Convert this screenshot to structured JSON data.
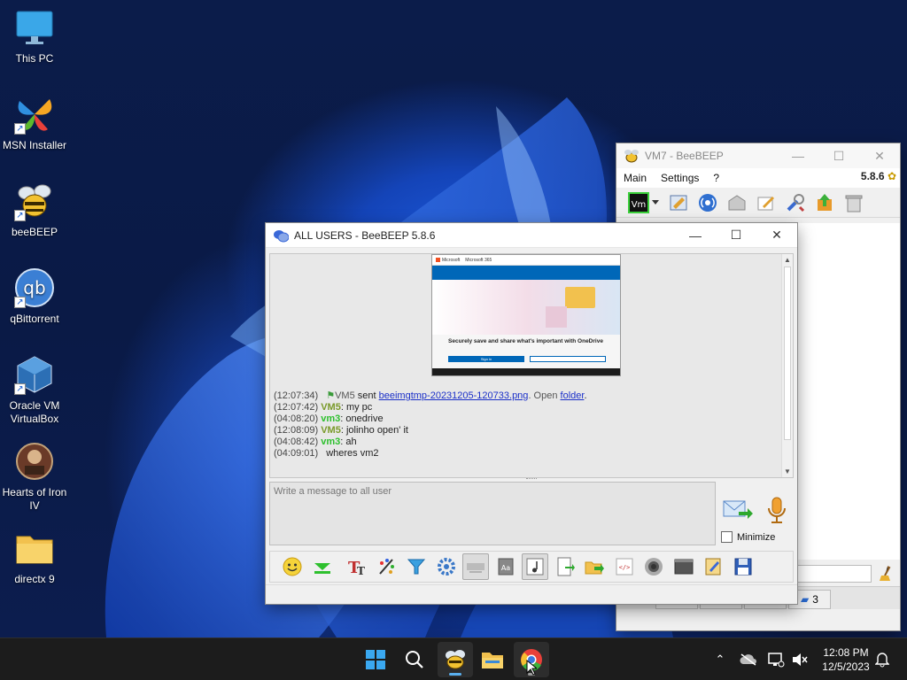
{
  "desktop": {
    "icons": [
      {
        "label": "This PC"
      },
      {
        "label": "MSN Installer"
      },
      {
        "label": "beeBEEP"
      },
      {
        "label": "qBittorrent"
      },
      {
        "label": "Oracle VM VirtualBox"
      },
      {
        "label": "Hearts of Iron IV"
      },
      {
        "label": "directx 9"
      }
    ]
  },
  "vm7_window": {
    "title": "VM7 - BeeBEEP",
    "menu": [
      "Main",
      "Settings",
      "?"
    ],
    "version": "5.8.6",
    "tab_count": "3"
  },
  "chat_window": {
    "title": "ALL USERS - BeeBEEP 5.8.6",
    "screenshot": {
      "brand": "Microsoft",
      "product": "Microsoft 365",
      "headline": "Securely save and share what's important with OneDrive",
      "signin": "Sign in"
    },
    "log": [
      {
        "time": "(12:07:34)",
        "user": "VM5",
        "pre": " sent ",
        "link": "beeimgtmp-20231205-120733.png",
        "mid": ". Open ",
        "link2": "folder",
        "post": "."
      },
      {
        "time": "(12:07:42)",
        "user": "VM5",
        "text": ": my pc"
      },
      {
        "time": "(04:08:20)",
        "user": "vm3",
        "text": ": onedrive"
      },
      {
        "time": "(12:08:09)",
        "user": "VM5",
        "text": ": jolinho open' it"
      },
      {
        "time": "(04:08:42)",
        "user": "vm3",
        "text": ": ah"
      },
      {
        "time": "(04:09:01)",
        "text": "wheres vm2"
      }
    ],
    "input_placeholder": "Write a message to all user",
    "minimize_label": "Minimize"
  },
  "taskbar": {
    "time": "12:08 PM",
    "date": "12/5/2023"
  },
  "colors": {
    "taskbar": "#1c1c1c",
    "vm5": "#7a9a2a",
    "vm3": "#2ec02e",
    "link": "#1a2fc8"
  }
}
